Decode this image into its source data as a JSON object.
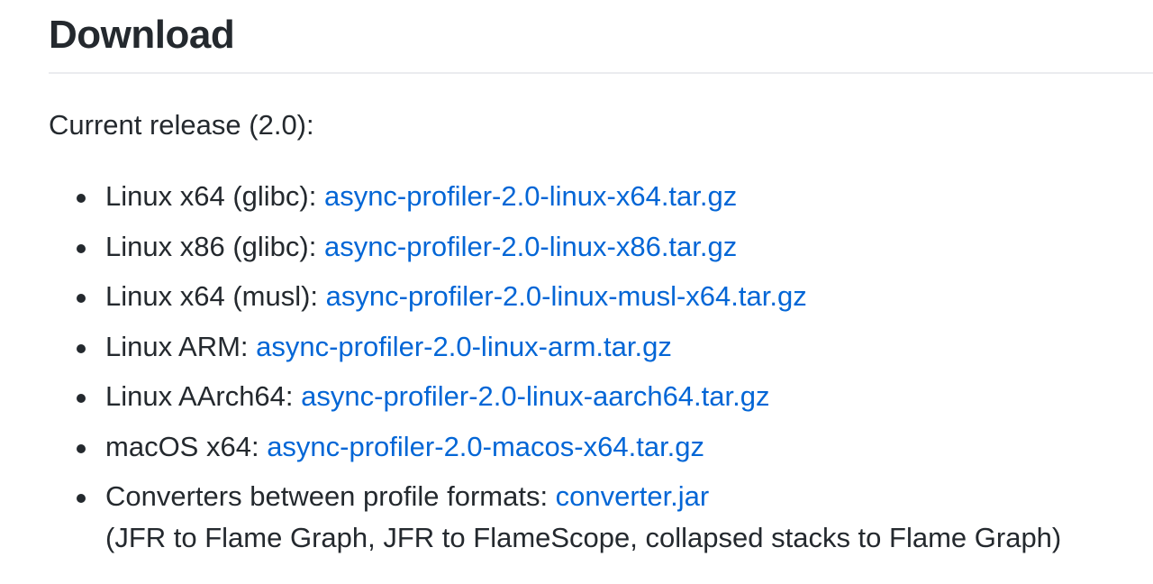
{
  "page": {
    "title": "Download",
    "intro": "Current release (2.0):"
  },
  "colors": {
    "text": "#24292e",
    "link": "#0366d6",
    "rule": "#eaecef"
  },
  "downloads": [
    {
      "label": "Linux x64 (glibc): ",
      "link": "async-profiler-2.0-linux-x64.tar.gz"
    },
    {
      "label": "Linux x86 (glibc): ",
      "link": "async-profiler-2.0-linux-x86.tar.gz"
    },
    {
      "label": "Linux x64 (musl): ",
      "link": "async-profiler-2.0-linux-musl-x64.tar.gz"
    },
    {
      "label": "Linux ARM: ",
      "link": "async-profiler-2.0-linux-arm.tar.gz"
    },
    {
      "label": "Linux AArch64: ",
      "link": "async-profiler-2.0-linux-aarch64.tar.gz"
    },
    {
      "label": "macOS x64: ",
      "link": "async-profiler-2.0-macos-x64.tar.gz"
    },
    {
      "label": "Converters between profile formats: ",
      "link": "converter.jar",
      "note": "(JFR to Flame Graph, JFR to FlameScope, collapsed stacks to Flame Graph)"
    }
  ]
}
